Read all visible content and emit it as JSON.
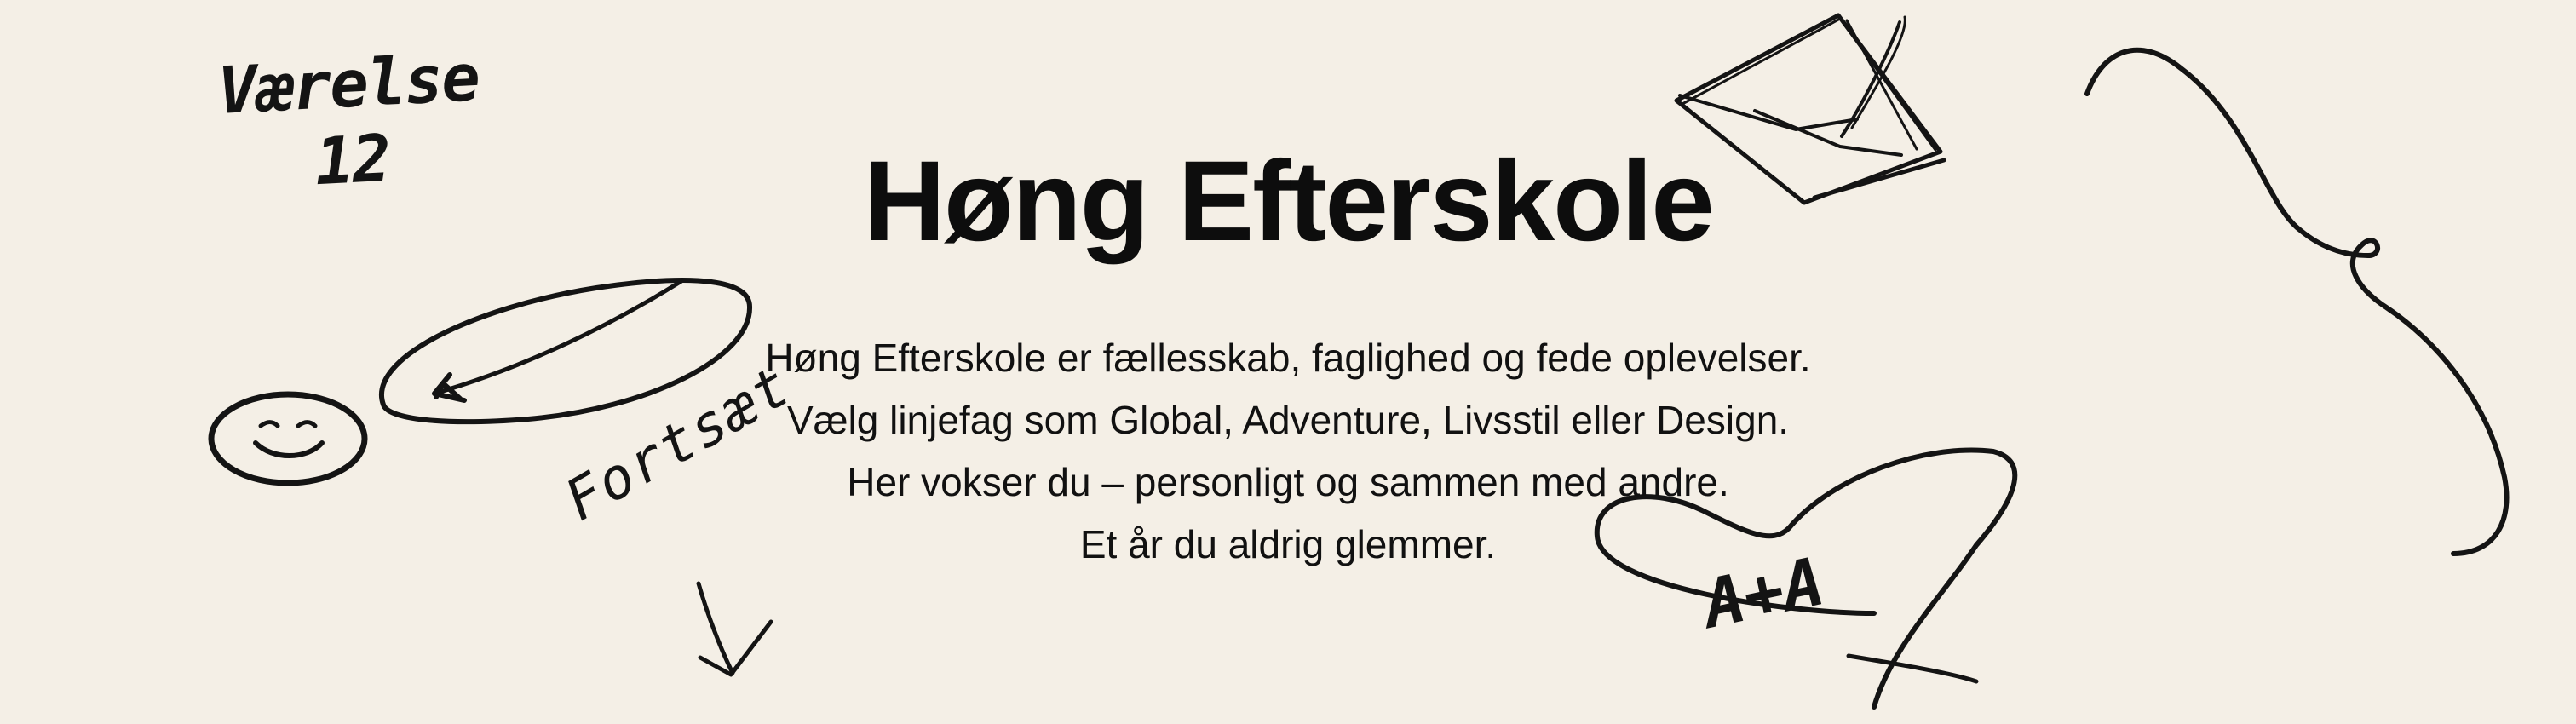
{
  "hero": {
    "title": "Høng Efterskole",
    "lines": [
      "Høng Efterskole er fællesskab, faglighed og fede oplevelser.",
      "Vælg linjefag som Global, Adventure, Livsstil eller Design.",
      "Her vokser du – personligt og sammen med andre.",
      "Et år du aldrig glemmer."
    ]
  },
  "doodles": {
    "room_note_line1": "Værelse",
    "room_note_line2": "12",
    "continue_note": "Fortsæt",
    "heart_note": "A+A"
  },
  "colors": {
    "background": "#f4efe6",
    "ink": "#141414"
  },
  "icons": [
    "envelope-doodle-icon",
    "smiley-doodle-icon",
    "ellipse-arrow-doodle-icon",
    "down-arrow-doodle-icon",
    "heart-doodle-icon",
    "squiggle-doodle-icon"
  ]
}
